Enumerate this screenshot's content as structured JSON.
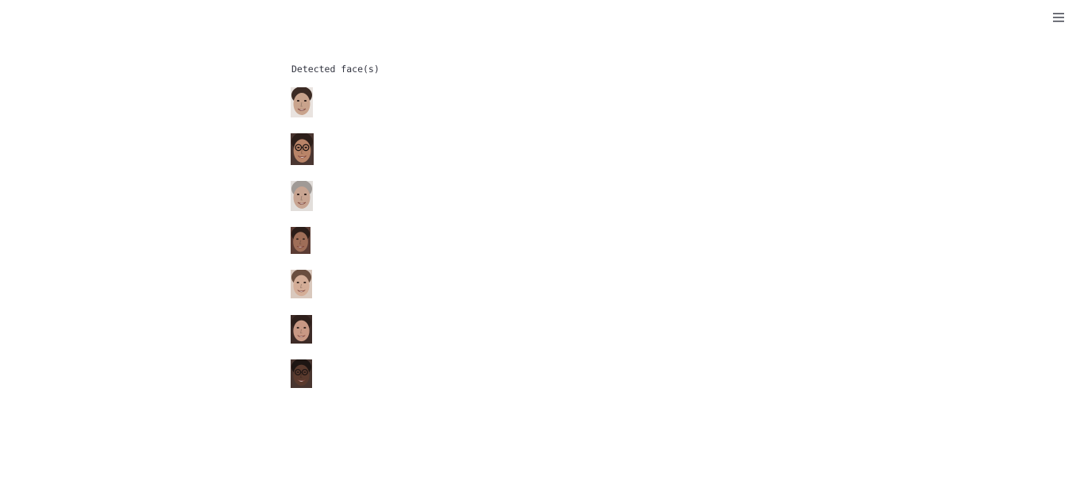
{
  "header": {
    "menu_icon": "hamburger-menu-icon"
  },
  "main": {
    "heading": "Detected face(s)",
    "faces": [
      {
        "name": "face-1",
        "skin": "#c9a38c",
        "hair": "#3c2b24",
        "bg": "#e9e3df",
        "glasses": false
      },
      {
        "name": "face-2",
        "skin": "#b98468",
        "hair": "#2d1f1a",
        "bg": "#4a3631",
        "glasses": true
      },
      {
        "name": "face-3",
        "skin": "#c8a592",
        "hair": "#a09a96",
        "bg": "#e2dedb",
        "glasses": false
      },
      {
        "name": "face-4",
        "skin": "#9f6e58",
        "hair": "#2b1d19",
        "bg": "#5b3c34",
        "glasses": false
      },
      {
        "name": "face-5",
        "skin": "#d4ad97",
        "hair": "#6a4e3f",
        "bg": "#d9c8bd",
        "glasses": false
      },
      {
        "name": "face-6",
        "skin": "#c99884",
        "hair": "#2e1f1b",
        "bg": "#3d2b27",
        "glasses": false
      },
      {
        "name": "face-7",
        "skin": "#5a3a2d",
        "hair": "#1e1613",
        "bg": "#48352f",
        "glasses": true
      }
    ]
  }
}
